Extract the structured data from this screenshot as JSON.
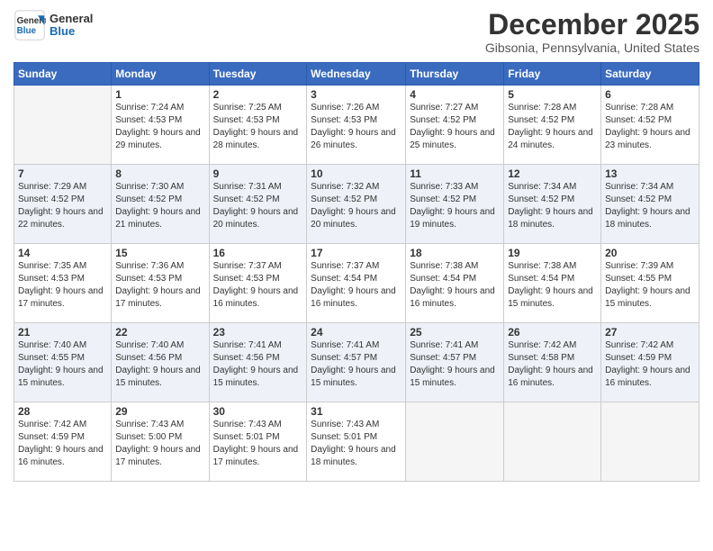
{
  "header": {
    "logo_general": "General",
    "logo_blue": "Blue",
    "month_title": "December 2025",
    "location": "Gibsonia, Pennsylvania, United States"
  },
  "days_of_week": [
    "Sunday",
    "Monday",
    "Tuesday",
    "Wednesday",
    "Thursday",
    "Friday",
    "Saturday"
  ],
  "weeks": [
    [
      {
        "day": "",
        "sunrise": "",
        "sunset": "",
        "daylight": "",
        "empty": true
      },
      {
        "day": "1",
        "sunrise": "7:24 AM",
        "sunset": "4:53 PM",
        "daylight": "9 hours and 29 minutes."
      },
      {
        "day": "2",
        "sunrise": "7:25 AM",
        "sunset": "4:53 PM",
        "daylight": "9 hours and 28 minutes."
      },
      {
        "day": "3",
        "sunrise": "7:26 AM",
        "sunset": "4:53 PM",
        "daylight": "9 hours and 26 minutes."
      },
      {
        "day": "4",
        "sunrise": "7:27 AM",
        "sunset": "4:52 PM",
        "daylight": "9 hours and 25 minutes."
      },
      {
        "day": "5",
        "sunrise": "7:28 AM",
        "sunset": "4:52 PM",
        "daylight": "9 hours and 24 minutes."
      },
      {
        "day": "6",
        "sunrise": "7:28 AM",
        "sunset": "4:52 PM",
        "daylight": "9 hours and 23 minutes."
      }
    ],
    [
      {
        "day": "7",
        "sunrise": "7:29 AM",
        "sunset": "4:52 PM",
        "daylight": "9 hours and 22 minutes."
      },
      {
        "day": "8",
        "sunrise": "7:30 AM",
        "sunset": "4:52 PM",
        "daylight": "9 hours and 21 minutes."
      },
      {
        "day": "9",
        "sunrise": "7:31 AM",
        "sunset": "4:52 PM",
        "daylight": "9 hours and 20 minutes."
      },
      {
        "day": "10",
        "sunrise": "7:32 AM",
        "sunset": "4:52 PM",
        "daylight": "9 hours and 20 minutes."
      },
      {
        "day": "11",
        "sunrise": "7:33 AM",
        "sunset": "4:52 PM",
        "daylight": "9 hours and 19 minutes."
      },
      {
        "day": "12",
        "sunrise": "7:34 AM",
        "sunset": "4:52 PM",
        "daylight": "9 hours and 18 minutes."
      },
      {
        "day": "13",
        "sunrise": "7:34 AM",
        "sunset": "4:52 PM",
        "daylight": "9 hours and 18 minutes."
      }
    ],
    [
      {
        "day": "14",
        "sunrise": "7:35 AM",
        "sunset": "4:53 PM",
        "daylight": "9 hours and 17 minutes."
      },
      {
        "day": "15",
        "sunrise": "7:36 AM",
        "sunset": "4:53 PM",
        "daylight": "9 hours and 17 minutes."
      },
      {
        "day": "16",
        "sunrise": "7:37 AM",
        "sunset": "4:53 PM",
        "daylight": "9 hours and 16 minutes."
      },
      {
        "day": "17",
        "sunrise": "7:37 AM",
        "sunset": "4:54 PM",
        "daylight": "9 hours and 16 minutes."
      },
      {
        "day": "18",
        "sunrise": "7:38 AM",
        "sunset": "4:54 PM",
        "daylight": "9 hours and 16 minutes."
      },
      {
        "day": "19",
        "sunrise": "7:38 AM",
        "sunset": "4:54 PM",
        "daylight": "9 hours and 15 minutes."
      },
      {
        "day": "20",
        "sunrise": "7:39 AM",
        "sunset": "4:55 PM",
        "daylight": "9 hours and 15 minutes."
      }
    ],
    [
      {
        "day": "21",
        "sunrise": "7:40 AM",
        "sunset": "4:55 PM",
        "daylight": "9 hours and 15 minutes."
      },
      {
        "day": "22",
        "sunrise": "7:40 AM",
        "sunset": "4:56 PM",
        "daylight": "9 hours and 15 minutes."
      },
      {
        "day": "23",
        "sunrise": "7:41 AM",
        "sunset": "4:56 PM",
        "daylight": "9 hours and 15 minutes."
      },
      {
        "day": "24",
        "sunrise": "7:41 AM",
        "sunset": "4:57 PM",
        "daylight": "9 hours and 15 minutes."
      },
      {
        "day": "25",
        "sunrise": "7:41 AM",
        "sunset": "4:57 PM",
        "daylight": "9 hours and 15 minutes."
      },
      {
        "day": "26",
        "sunrise": "7:42 AM",
        "sunset": "4:58 PM",
        "daylight": "9 hours and 16 minutes."
      },
      {
        "day": "27",
        "sunrise": "7:42 AM",
        "sunset": "4:59 PM",
        "daylight": "9 hours and 16 minutes."
      }
    ],
    [
      {
        "day": "28",
        "sunrise": "7:42 AM",
        "sunset": "4:59 PM",
        "daylight": "9 hours and 16 minutes."
      },
      {
        "day": "29",
        "sunrise": "7:43 AM",
        "sunset": "5:00 PM",
        "daylight": "9 hours and 17 minutes."
      },
      {
        "day": "30",
        "sunrise": "7:43 AM",
        "sunset": "5:01 PM",
        "daylight": "9 hours and 17 minutes."
      },
      {
        "day": "31",
        "sunrise": "7:43 AM",
        "sunset": "5:01 PM",
        "daylight": "9 hours and 18 minutes."
      },
      {
        "day": "",
        "sunrise": "",
        "sunset": "",
        "daylight": "",
        "empty": true
      },
      {
        "day": "",
        "sunrise": "",
        "sunset": "",
        "daylight": "",
        "empty": true
      },
      {
        "day": "",
        "sunrise": "",
        "sunset": "",
        "daylight": "",
        "empty": true
      }
    ]
  ],
  "labels": {
    "sunrise": "Sunrise:",
    "sunset": "Sunset:",
    "daylight": "Daylight:"
  }
}
